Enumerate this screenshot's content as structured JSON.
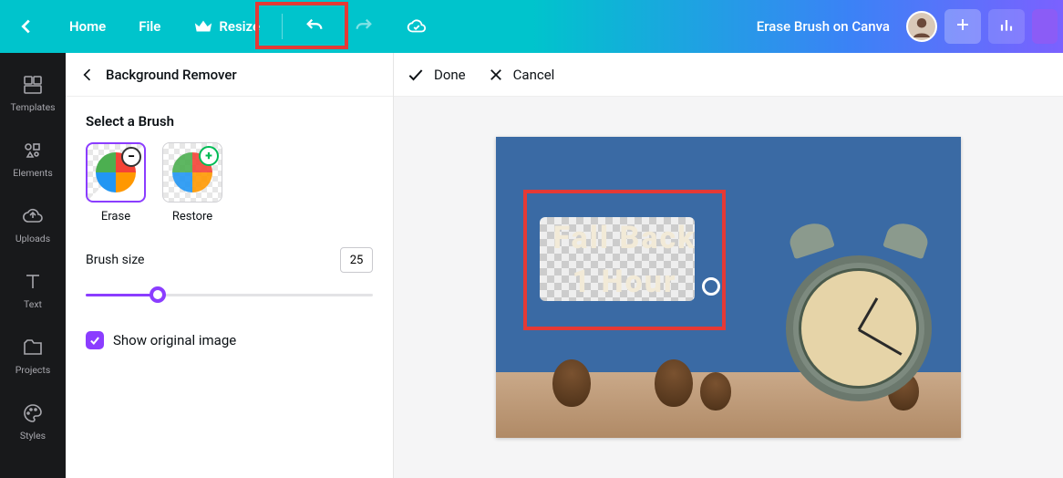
{
  "topbar": {
    "home_label": "Home",
    "file_label": "File",
    "resize_label": "Resize",
    "doc_title": "Erase Brush on Canva"
  },
  "rail": {
    "templates": "Templates",
    "elements": "Elements",
    "uploads": "Uploads",
    "text": "Text",
    "projects": "Projects",
    "styles": "Styles"
  },
  "panel": {
    "title": "Background Remover",
    "section_title": "Select a Brush",
    "erase_label": "Erase",
    "restore_label": "Restore",
    "brush_size_label": "Brush size",
    "brush_size_value": "25",
    "show_original_label": "Show original image",
    "show_original_checked": true
  },
  "actionbar": {
    "done_label": "Done",
    "cancel_label": "Cancel"
  },
  "design": {
    "line1": "Fall Back",
    "line2": "1 Hour"
  },
  "colors": {
    "accent": "#8b3dff",
    "topbar_start": "#00c4cc",
    "topbar_end": "#7b61ff",
    "annotation": "#e53935"
  }
}
